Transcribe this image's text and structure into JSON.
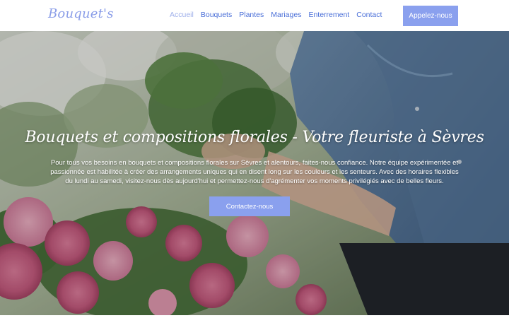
{
  "header": {
    "logo": "Bouquet's",
    "nav": [
      {
        "label": "Accueil",
        "active": true
      },
      {
        "label": "Bouquets",
        "active": false
      },
      {
        "label": "Plantes",
        "active": false
      },
      {
        "label": "Mariages",
        "active": false
      },
      {
        "label": "Enterrement",
        "active": false
      },
      {
        "label": "Contact",
        "active": false
      }
    ],
    "cta_label": "Appelez-nous"
  },
  "hero": {
    "title": "Bouquets et compositions florales - Votre fleuriste à Sèvres",
    "text": "Pour tous vos besoins en bouquets et compositions florales sur Sèvres et alentours, faites-nous confiance. Notre équipe expérimentée et passionnée est habilitée à créer des arrangements uniques qui en disent long sur les couleurs et les senteurs. Avec des horaires flexibles du lundi au samedi, visitez-nous dès aujourd'hui et permettez-nous d'agrémenter vos moments privilégiés avec de belles fleurs.",
    "button_label": "Contactez-nous"
  },
  "colors": {
    "accent": "#8aa0ee",
    "nav_link": "#4a6fd8",
    "nav_active": "#9fb0ea"
  }
}
